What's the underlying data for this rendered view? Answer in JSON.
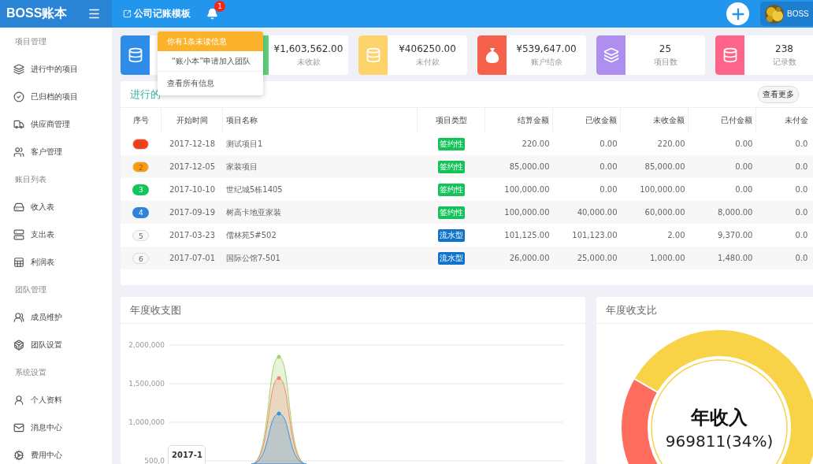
{
  "header": {
    "logo": "BOSS账本",
    "template_link": "公司记账模板",
    "notification_count": "1",
    "user": "BOSS"
  },
  "notifications": {
    "title": "你有1条未读信息",
    "items": [
      "“账小本”申请加入团队"
    ],
    "footer": "查看所有信息"
  },
  "sidebar": {
    "items": [
      {
        "kind": "header",
        "label": "项目管理"
      },
      {
        "kind": "item",
        "label": "进行中的项目"
      },
      {
        "kind": "item",
        "label": "已归档的项目"
      },
      {
        "kind": "item",
        "label": "供应商管理"
      },
      {
        "kind": "item",
        "label": "客户管理"
      },
      {
        "kind": "header",
        "label": "账目列表"
      },
      {
        "kind": "item",
        "label": "收入表"
      },
      {
        "kind": "item",
        "label": "支出表"
      },
      {
        "kind": "item",
        "label": "利润表"
      },
      {
        "kind": "header",
        "label": "团队管理"
      },
      {
        "kind": "item",
        "label": "成员维护"
      },
      {
        "kind": "item",
        "label": "团队设置"
      },
      {
        "kind": "header",
        "label": "系统设置"
      },
      {
        "kind": "item",
        "label": "个人资料"
      },
      {
        "kind": "item",
        "label": "消息中心"
      },
      {
        "kind": "item",
        "label": "费用中心"
      }
    ]
  },
  "stats": [
    {
      "color": "#2f8ce8"
    },
    {
      "color": "#5fd07a",
      "value": "¥1,603,562.00",
      "label": "未收款"
    },
    {
      "color": "#fed36c",
      "value": "¥406250.00",
      "label": "未付款"
    },
    {
      "color": "#f5614a",
      "value": "¥539,647.00",
      "label": "账户结余"
    },
    {
      "color": "#ae8ff0",
      "value": "25",
      "label": "项目数"
    },
    {
      "color": "#fe6389",
      "value": "238",
      "label": "记录数"
    }
  ],
  "projects": {
    "title": "进行的",
    "more_button": "查看更多",
    "columns": [
      "序号",
      "开始时间",
      "项目名称",
      "项目类型",
      "结算金额",
      "已收金额",
      "未收金额",
      "已付金额",
      "未付金"
    ],
    "rows": [
      {
        "no": "1",
        "color": "#fc3a13",
        "start": "2017-12-18",
        "name": "测试项目1",
        "type": "签约性",
        "kind": "contract",
        "settled": "220.00",
        "received": "0.00",
        "unreceived": "220.00",
        "paid": "0.00",
        "unpaid": "0.0"
      },
      {
        "no": "2",
        "color": "#fe9a0a",
        "start": "2017-12-05",
        "name": "家装项目",
        "type": "签约性",
        "kind": "contract",
        "settled": "85,000.00",
        "received": "0.00",
        "unreceived": "85,000.00",
        "paid": "0.00",
        "unpaid": "0.0"
      },
      {
        "no": "3",
        "color": "#12c45a",
        "start": "2017-10-10",
        "name": "世纪城5栋1405",
        "type": "签约性",
        "kind": "contract",
        "settled": "100,000.00",
        "received": "0.00",
        "unreceived": "100,000.00",
        "paid": "0.00",
        "unpaid": "0.0"
      },
      {
        "no": "4",
        "color": "#3083d6",
        "start": "2017-09-19",
        "name": "树高卡地亚家装",
        "type": "签约性",
        "kind": "contract",
        "settled": "100,000.00",
        "received": "40,000.00",
        "unreceived": "60,000.00",
        "paid": "8,000.00",
        "unpaid": "0.0"
      },
      {
        "no": "5",
        "color": "#f7f7f7",
        "start": "2017-03-23",
        "name": "儒林苑5#502",
        "type": "流水型",
        "kind": "flow",
        "settled": "101,125.00",
        "received": "101,123.00",
        "unreceived": "2.00",
        "paid": "9,370.00",
        "unpaid": "0.0"
      },
      {
        "no": "6",
        "color": "#f7f7f7",
        "start": "2017-07-01",
        "name": "国际公馆7-501",
        "type": "流水型",
        "kind": "flow",
        "settled": "26,000.00",
        "received": "25,000.00",
        "unreceived": "1,000.00",
        "paid": "1,480.00",
        "unpaid": "0.0"
      }
    ]
  },
  "income_chart": {
    "title": "年度收支图",
    "tooltip": "2017-1",
    "y_axis_labels": [
      "2,000,000",
      "1,500,000",
      "1,000,000",
      "500,0"
    ]
  },
  "ratio_chart": {
    "title": "年度收支比",
    "center_label": "年收入",
    "center_value": "969811(34%)",
    "chart_data": {
      "type": "donut",
      "values": [
        34,
        66
      ]
    }
  }
}
